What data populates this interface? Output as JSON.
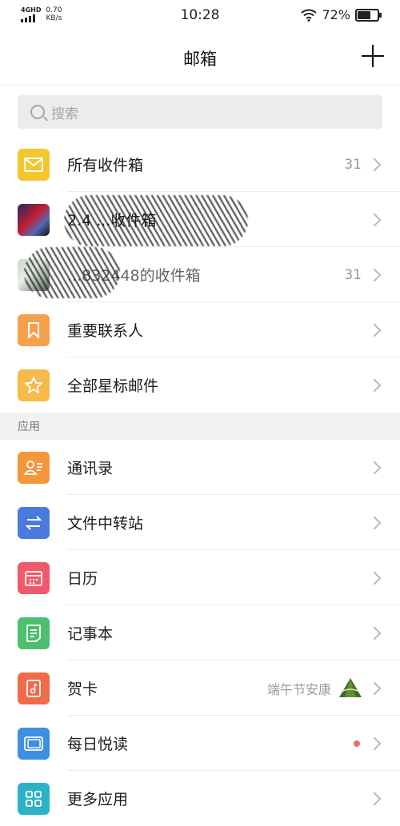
{
  "status_bar": {
    "network": "4GHD",
    "speed_value": "0.70",
    "speed_unit": "KB/s",
    "time": "10:28",
    "battery_text": "72%",
    "battery_level": 0.72
  },
  "nav": {
    "title": "邮箱"
  },
  "search": {
    "placeholder": "搜索"
  },
  "mailboxes": [
    {
      "label": "所有收件箱",
      "count": "31",
      "icon": "mail-icon",
      "color": "#f4c72f"
    },
    {
      "label": "2.4 ...收件箱",
      "count": "",
      "icon": "avatar"
    },
    {
      "label": "...832448的收件箱",
      "count": "31",
      "icon": "avatar"
    },
    {
      "label": "重要联系人",
      "count": "",
      "icon": "bookmark-icon",
      "color": "#f5a04a"
    },
    {
      "label": "全部星标邮件",
      "count": "",
      "icon": "star-icon",
      "color": "#f6b94a"
    }
  ],
  "apps_section": {
    "title": "应用"
  },
  "apps": [
    {
      "label": "通讯录",
      "icon": "contacts-icon",
      "color": "#f6963a"
    },
    {
      "label": "文件中转站",
      "icon": "transfer-icon",
      "color": "#4a7bdc"
    },
    {
      "label": "日历",
      "icon": "calendar-icon",
      "color": "#ee5a6c"
    },
    {
      "label": "记事本",
      "icon": "notepad-icon",
      "color": "#4dbf6e"
    },
    {
      "label": "贺卡",
      "extra": "端午节安康",
      "icon": "greeting-card-icon",
      "color": "#f26a4a"
    },
    {
      "label": "每日悦读",
      "icon": "reading-icon",
      "color": "#3f8fe0"
    },
    {
      "label": "更多应用",
      "icon": "more-apps-icon",
      "color": "#2ab3c4"
    }
  ]
}
